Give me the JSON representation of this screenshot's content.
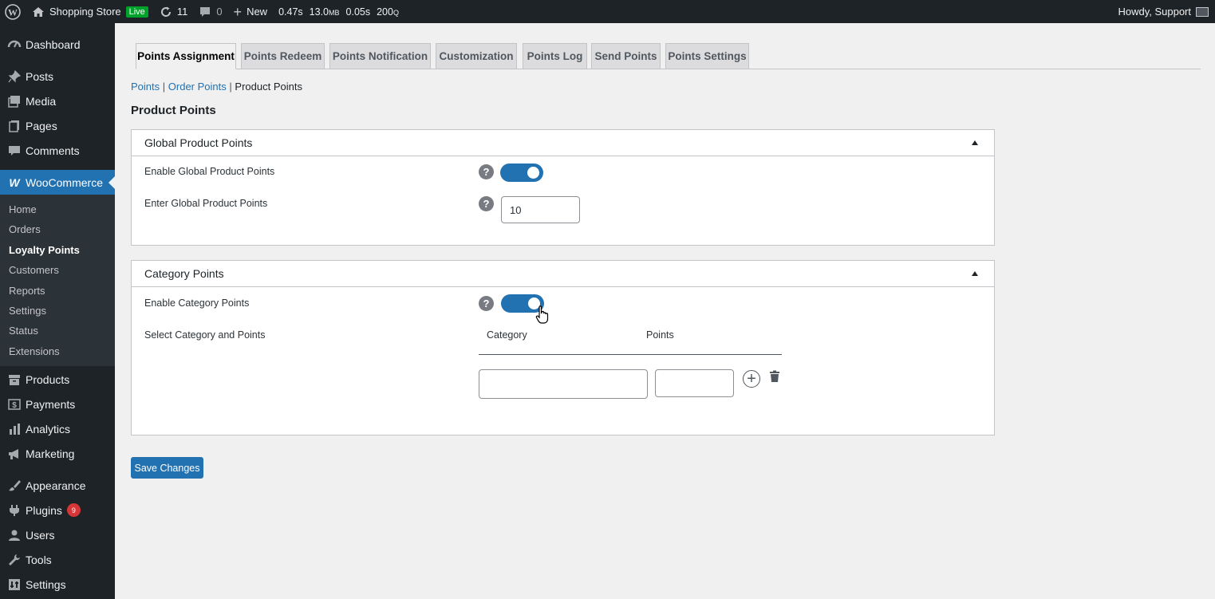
{
  "adminbar": {
    "site_name": "Shopping Store",
    "live_label": "Live",
    "updates_count": "11",
    "comments_count": "0",
    "new_label": "New",
    "qm": [
      "0.47s",
      "13.0",
      "MB",
      "0.05s",
      "200",
      "Q"
    ],
    "howdy": "Howdy, Support"
  },
  "sidebar": {
    "dashboard": "Dashboard",
    "posts": "Posts",
    "media": "Media",
    "pages": "Pages",
    "comments": "Comments",
    "woocommerce": "WooCommerce",
    "sub": [
      "Home",
      "Orders",
      "Loyalty Points",
      "Customers",
      "Reports",
      "Settings",
      "Status",
      "Extensions"
    ],
    "products": "Products",
    "payments": "Payments",
    "analytics": "Analytics",
    "marketing": "Marketing",
    "appearance": "Appearance",
    "plugins": "Plugins",
    "plugins_badge": "9",
    "users": "Users",
    "tools": "Tools",
    "settings": "Settings"
  },
  "tabs": [
    "Points Assignment",
    "Points Redeem",
    "Points Notification",
    "Customization",
    "Points Log",
    "Send Points",
    "Points Settings"
  ],
  "subnav": {
    "points": "Points",
    "sep": "|",
    "order_points": "Order Points",
    "current": "Product Points"
  },
  "page_title": "Product Points",
  "global_panel": {
    "title": "Global Product Points",
    "enable_label": "Enable Global Product Points",
    "enter_label": "Enter Global Product Points",
    "points_value": "10",
    "help": "?"
  },
  "category_panel": {
    "title": "Category Points",
    "enable_label": "Enable Category Points",
    "select_label": "Select Category and Points",
    "col_category": "Category",
    "col_points": "Points",
    "help": "?",
    "add": "+"
  },
  "save_label": "Save Changes",
  "colors": {
    "adminbar_bg": "#1d2327",
    "accent": "#2271b1",
    "live": "#00a32a",
    "badge": "#d63638"
  }
}
